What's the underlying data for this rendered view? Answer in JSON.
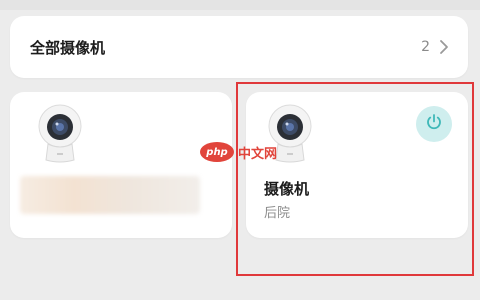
{
  "all_cameras": {
    "title": "全部摄像机",
    "count": "2",
    "chevron_icon": "chevron-right-icon"
  },
  "device_cards": [
    {
      "icon": "security-camera-icon",
      "name_blurred": true
    },
    {
      "icon": "security-camera-icon",
      "power_icon": "power-icon",
      "name": "摄像机",
      "room": "后院"
    }
  ],
  "watermark": {
    "logo": "php",
    "text": "中文网"
  },
  "colors": {
    "background": "#ececec",
    "card": "#ffffff",
    "accent_teal": "#3fb8b8",
    "power_bg": "#cfeeee",
    "highlight_red": "#e0393b",
    "watermark_red": "#e1443b"
  }
}
